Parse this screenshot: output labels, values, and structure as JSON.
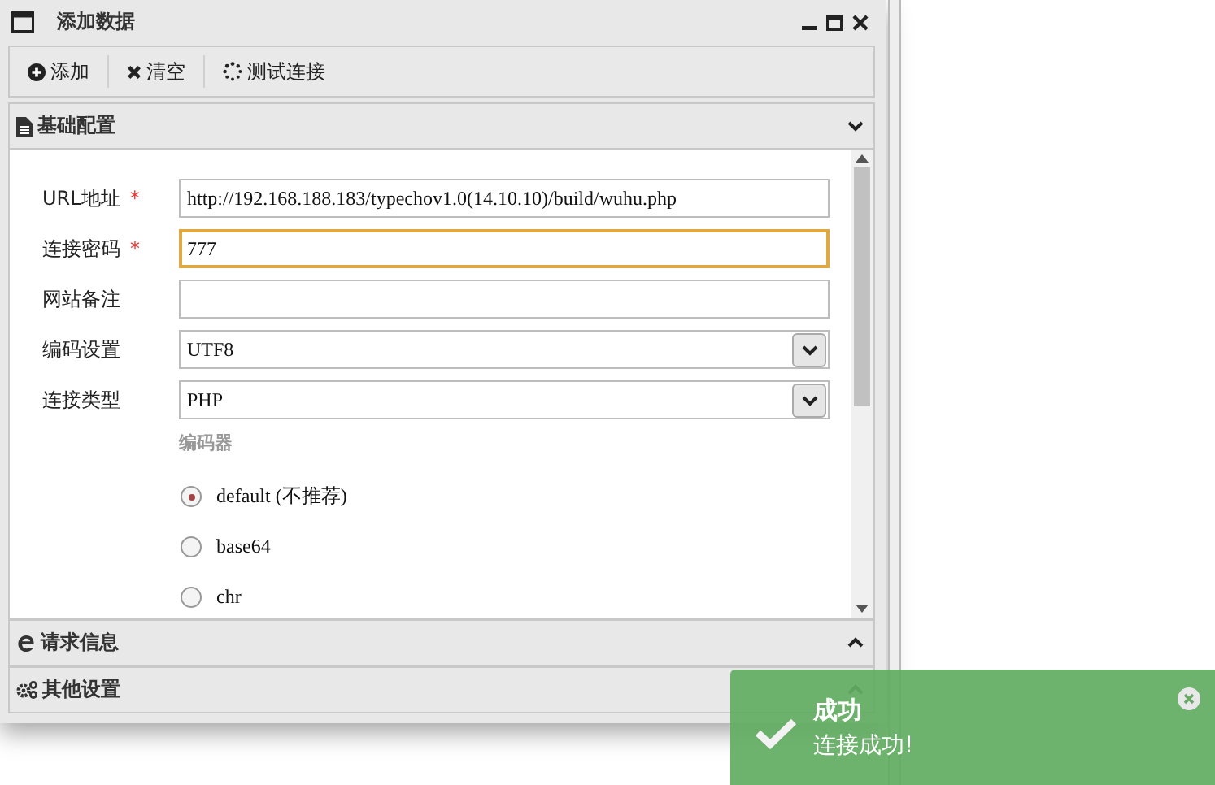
{
  "window": {
    "title": "添加数据"
  },
  "toolbar": [
    {
      "kind": "add",
      "label": "添加"
    },
    {
      "kind": "clear",
      "label": "清空"
    },
    {
      "kind": "test",
      "label": "测试连接"
    }
  ],
  "sections": [
    {
      "kind": "basic",
      "title": "基础配置",
      "expanded": true
    },
    {
      "kind": "request",
      "title": "请求信息",
      "expanded": false
    },
    {
      "kind": "other",
      "title": "其他设置",
      "expanded": false
    }
  ],
  "fields": [
    {
      "kind": "text",
      "label": "URL地址",
      "required": true,
      "value": "http://192.168.188.183/typechov1.0(14.10.10)/build/wuhu.php",
      "focused": false
    },
    {
      "kind": "text",
      "label": "连接密码",
      "required": true,
      "value": "777",
      "focused": true
    },
    {
      "kind": "text",
      "label": "网站备注",
      "required": false,
      "focused": false
    },
    {
      "kind": "select",
      "label": "编码设置",
      "required": false,
      "value": "UTF8",
      "focused": false
    },
    {
      "kind": "select",
      "label": "连接类型",
      "required": false,
      "value": "PHP",
      "focused": false
    }
  ],
  "required_mark": "*",
  "encoder": {
    "label": "编码器",
    "options": [
      {
        "label": "default (不推荐)",
        "selected": true
      },
      {
        "label": "base64",
        "selected": false
      },
      {
        "label": "chr",
        "selected": false
      }
    ]
  },
  "toast": {
    "title": "成功",
    "message": "连接成功!"
  }
}
